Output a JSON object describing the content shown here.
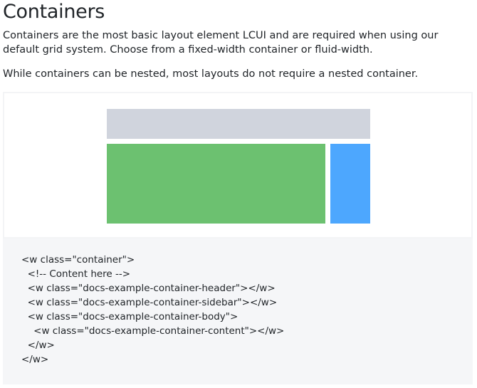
{
  "heading": "Containers",
  "paragraphs": [
    "Containers are the most basic layout element LCUI and are required when using our default grid system. Choose from a fixed-width container or fluid-width.",
    "While containers can be nested, most layouts do not require a nested container."
  ],
  "example": {
    "colors": {
      "header": "#d0d4dd",
      "content": "#6cc170",
      "sidebar": "#4da7fe"
    }
  },
  "code": [
    "<w class=\"container\">",
    "  <!-- Content here -->",
    "  <w class=\"docs-example-container-header\"></w>",
    "  <w class=\"docs-example-container-sidebar\"></w>",
    "  <w class=\"docs-example-container-body\">",
    "    <w class=\"docs-example-container-content\"></w>",
    "  </w>",
    "</w>"
  ]
}
